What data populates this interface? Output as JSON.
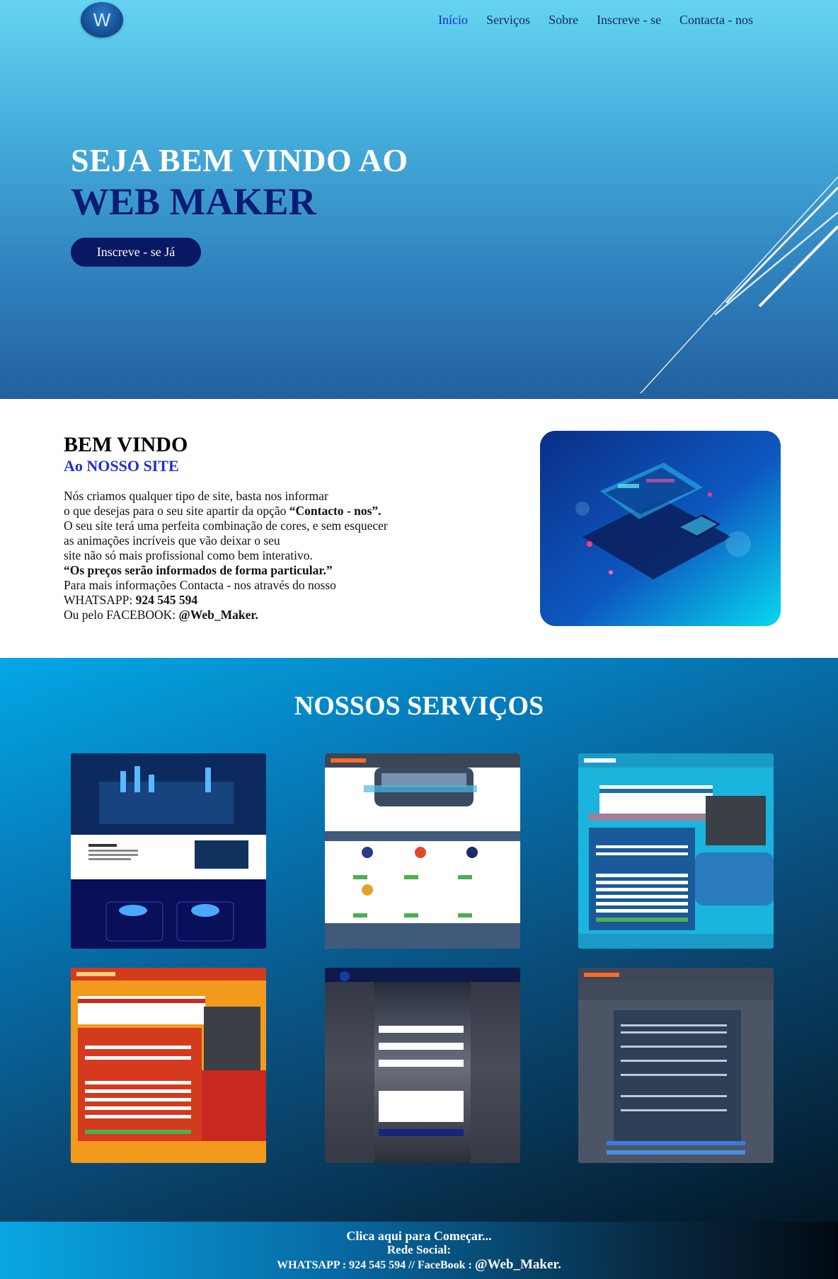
{
  "header": {
    "logo_letter": "W",
    "nav": [
      "Início",
      "Serviços",
      "Sobre",
      "Inscreve - se",
      "Contacta - nos"
    ]
  },
  "hero": {
    "line1": "SEJA BEM VINDO AO",
    "line2": "WEB MAKER",
    "cta": "Inscreve - se Já"
  },
  "welcome": {
    "title": "BEM VINDO",
    "subtitle": "Ao NOSSO SITE",
    "lines": [
      "Nós criamos qualquer tipo de site, basta nos informar",
      "o que desejas para o seu site apartir da opção ",
      "“Contacto - nos”.",
      "O seu site terá uma perfeita combinação de cores, e sem esquecer",
      "as animações incríveis que vão deixar o seu",
      "site não só mais profissional como bem interativo.",
      "“Os preços serão informados de forma particular.”",
      "Para mais informações Contacta - nos através do nosso",
      "WHATSAPP: ",
      "924 545 594",
      "Ou pelo FACEBOOK: ",
      "@Web_Maker."
    ]
  },
  "services": {
    "title": "NOSSOS SERVIÇOS",
    "cards": [
      {
        "brand": "Seja Bem-vindo",
        "theme": "dark-blue"
      },
      {
        "brand": "ANGOVIAGENS",
        "headline": "Bem-vindo ao AngoViagens",
        "section": "Confirmar o seu bilhete de passagem"
      },
      {
        "brand": "ANGOVIAGENS",
        "headline": "Tabela de viagens da Macon",
        "section": "Reservar bilhete de Macon"
      },
      {
        "brand": "ANGOVIAGENS",
        "headline": "Tabela de viagens da Tcul",
        "section": "Reservar bilhete do Tcul"
      },
      {
        "brand": "Seus Informação",
        "section": "Sua Mensagem"
      },
      {
        "brand": "ANGOVIAGENS",
        "headline": "Inscrever-se",
        "section": "Seus informações"
      }
    ]
  },
  "footer": {
    "cta": "Clica aqui para Começar...",
    "social_label": "Rede Social:",
    "contact_prefix": "WHATSAPP : 924 545 594 // FaceBook : ",
    "contact_handle": "@Web_Maker."
  }
}
